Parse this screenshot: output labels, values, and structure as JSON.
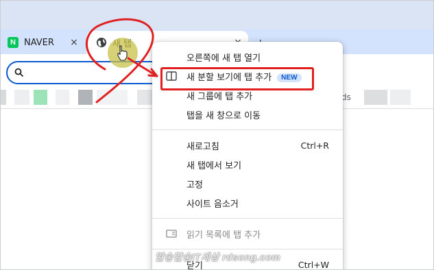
{
  "tabs": {
    "naver": {
      "title": "NAVER",
      "logo_letter": "N",
      "close": "×"
    },
    "active": {
      "title": "새 탭",
      "close": "×"
    },
    "new_tab": "+"
  },
  "bookmarks": {
    "partial_text": "ds"
  },
  "menu": {
    "items": [
      {
        "label": "오른쪽에 새 탭 열기"
      },
      {
        "label": "새 분할 보기에 탭 추가",
        "badge": "NEW",
        "icon": "split-view-icon"
      },
      {
        "label": "새 그룹에 탭 추가"
      },
      {
        "label": "탭을 새 창으로 이동"
      },
      {
        "label": "새로고침",
        "shortcut": "Ctrl+R"
      },
      {
        "label": "새 탭에서 보기"
      },
      {
        "label": "고정"
      },
      {
        "label": "사이트 음소거"
      },
      {
        "label": "읽기 목록에 탭 추가",
        "icon": "reading-list-icon"
      },
      {
        "label": "닫기",
        "shortcut": "Ctrl+W"
      }
    ]
  },
  "watermark": "알송달송IT세상 rdsong.com",
  "colors": {
    "accent": "#0b57d0",
    "annotation": "#e02020",
    "tab_strip": "#d3e3fd"
  }
}
